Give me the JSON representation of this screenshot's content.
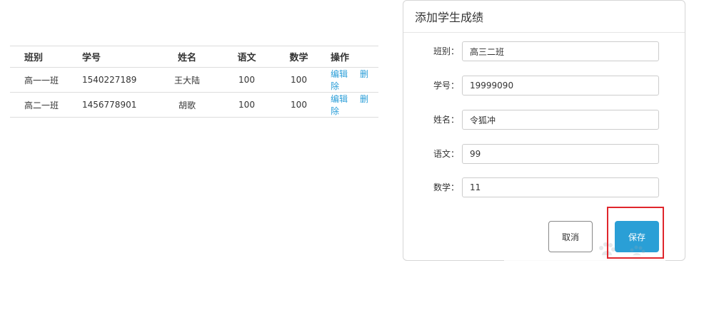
{
  "table": {
    "headers": [
      "班别",
      "学号",
      "姓名",
      "语文",
      "数学",
      "操作"
    ],
    "rows": [
      {
        "class": "高一一班",
        "id": "1540227189",
        "name": "王大陆",
        "chinese": "100",
        "math": "100",
        "edit": "编辑",
        "delete": "删除"
      },
      {
        "class": "高二一班",
        "id": "1456778901",
        "name": "胡歌",
        "chinese": "100",
        "math": "100",
        "edit": "编辑",
        "delete": "删除"
      }
    ]
  },
  "modal": {
    "title": "添加学生成绩",
    "fields": [
      {
        "label": "班别：",
        "value": "高三二班"
      },
      {
        "label": "学号：",
        "value": "19999090"
      },
      {
        "label": "姓名：",
        "value": "令狐冲"
      },
      {
        "label": "语文：",
        "value": "99"
      },
      {
        "label": "数学：",
        "value": "11"
      }
    ],
    "cancel_label": "取消",
    "save_label": "保存"
  },
  "colors": {
    "accent": "#2a9fd6",
    "link": "#2b9ed8",
    "highlight": "#e0262c"
  }
}
